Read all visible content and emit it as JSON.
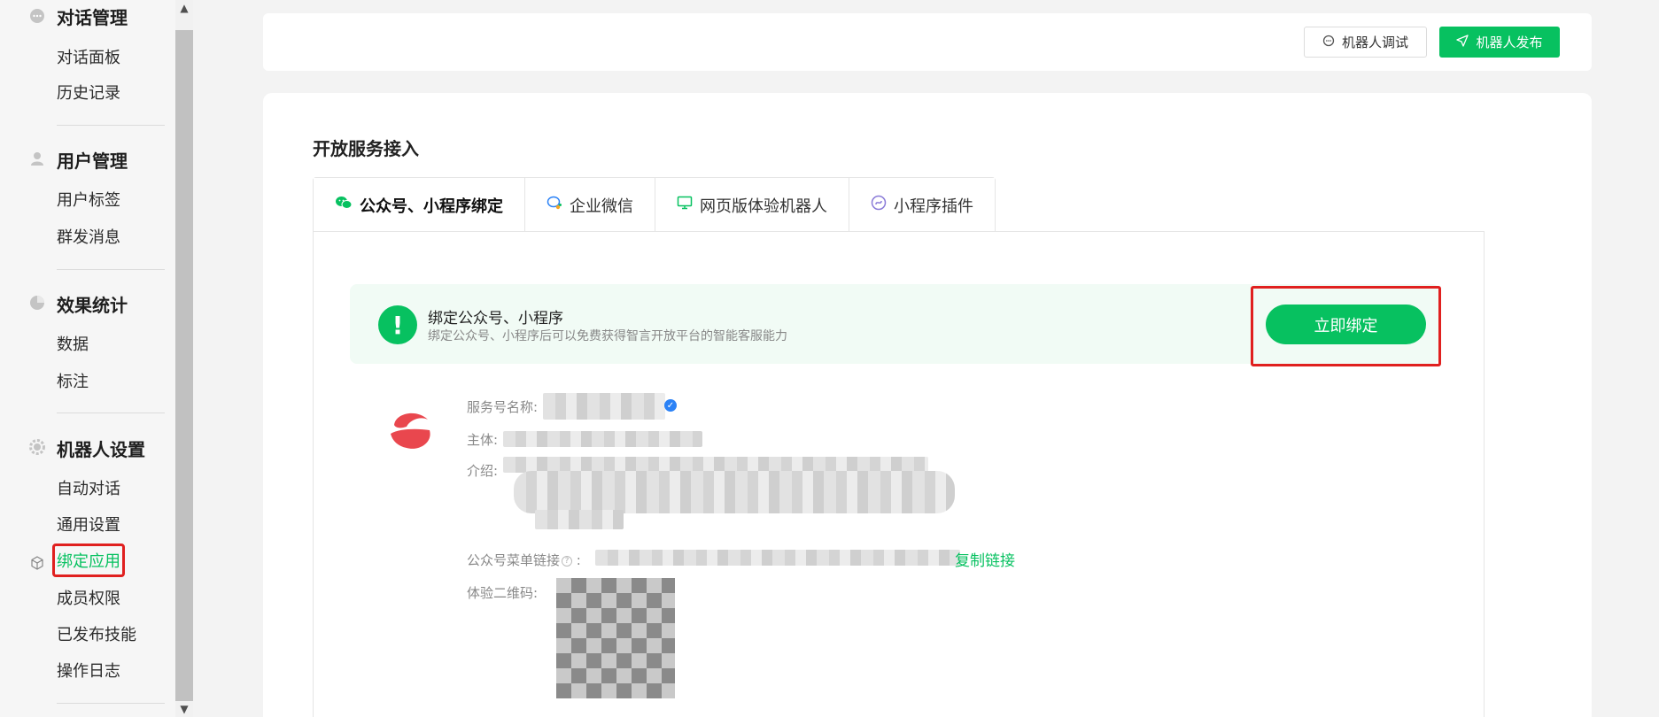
{
  "sidebar": {
    "groups": [
      {
        "title": "对话管理",
        "icon": "chat-bubble-icon",
        "items": [
          "对话面板",
          "历史记录"
        ]
      },
      {
        "title": "用户管理",
        "icon": "user-icon",
        "items": [
          "用户标签",
          "群发消息"
        ]
      },
      {
        "title": "效果统计",
        "icon": "pie-chart-icon",
        "items": [
          "数据",
          "标注"
        ]
      },
      {
        "title": "机器人设置",
        "icon": "gear-icon",
        "items": [
          "自动对话",
          "通用设置",
          "绑定应用",
          "成员权限",
          "已发布技能",
          "操作日志"
        ]
      }
    ],
    "active_item": "绑定应用"
  },
  "header": {
    "debug_label": "机器人调试",
    "publish_label": "机器人发布"
  },
  "main": {
    "section_title": "开放服务接入",
    "tabs": [
      {
        "label": "公众号、小程序绑定",
        "icon": "wechat-icon",
        "active": true
      },
      {
        "label": "企业微信",
        "icon": "wecom-icon",
        "active": false
      },
      {
        "label": "网页版体验机器人",
        "icon": "monitor-icon",
        "active": false
      },
      {
        "label": "小程序插件",
        "icon": "miniprogram-icon",
        "active": false
      }
    ],
    "alert": {
      "title": "绑定公众号、小程序",
      "desc": "绑定公众号、小程序后可以免费获得智言开放平台的智能客服能力",
      "button": "立即绑定"
    },
    "info": {
      "service_name_label": "服务号名称:",
      "subject_label": "主体:",
      "intro_label": "介绍:",
      "menu_link_label": "公众号菜单链接",
      "menu_link_suffix": ":",
      "copy_link": "复制链接",
      "qr_label": "体验二维码:"
    }
  },
  "colors": {
    "accent": "#07c160",
    "highlight": "#e0201f"
  }
}
